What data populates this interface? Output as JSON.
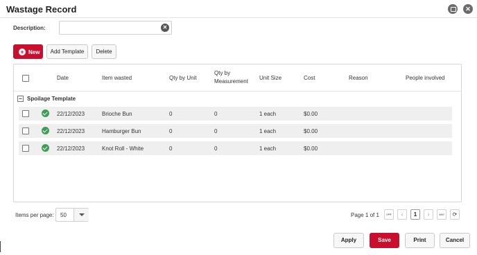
{
  "window": {
    "title": "Wastage Record",
    "minimize_icon": "window-restore-icon",
    "close_icon": "close-icon",
    "close_glyph": "✕"
  },
  "description": {
    "label": "Description:",
    "value": "",
    "placeholder": "",
    "clear_icon": "clear-icon",
    "clear_glyph": "✕"
  },
  "toolbar": {
    "new_label": "New",
    "new_icon": "plus-circle-icon",
    "new_glyph": "+",
    "add_template_label": "Add Template",
    "delete_label": "Delete"
  },
  "accent_color": "#c8102e",
  "status_color": "#3f9d58",
  "table": {
    "headers": {
      "date": "Date",
      "item_wasted": "Item wasted",
      "qty_by_unit": "Qty by Unit",
      "qty_by_measurement_1": "Qty by",
      "qty_by_measurement_2": "Measurement",
      "unit_size": "Unit Size",
      "cost": "Cost",
      "reason": "Reason",
      "people_involved": "People involved"
    },
    "group": {
      "toggle": "−",
      "label": "Spoilage Template"
    },
    "rows": [
      {
        "date": "22/12/2023",
        "item": "Brioche Bun",
        "qty_unit": "0",
        "qty_measure": "0",
        "unit_size": "1 each",
        "cost": "$0.00",
        "reason": "",
        "people": "",
        "status_icon": "check-circle-icon"
      },
      {
        "date": "22/12/2023",
        "item": "Hamburger Bun",
        "qty_unit": "0",
        "qty_measure": "0",
        "unit_size": "1 each",
        "cost": "$0.00",
        "reason": "",
        "people": "",
        "status_icon": "check-circle-icon"
      },
      {
        "date": "22/12/2023",
        "item": "Knot Roll - White",
        "qty_unit": "0",
        "qty_measure": "0",
        "unit_size": "1 each",
        "cost": "$0.00",
        "reason": "",
        "people": "",
        "status_icon": "check-circle-icon"
      }
    ]
  },
  "pagination": {
    "items_per_page_label": "Items per page:",
    "items_per_page_value": "50",
    "page_info": "Page 1 of 1",
    "first": "⏮",
    "prev": "‹",
    "current": "1",
    "next": "›",
    "last": "⏭",
    "refresh": "⟳"
  },
  "footer": {
    "apply_label": "Apply",
    "save_label": "Save",
    "print_label": "Print",
    "cancel_label": "Cancel"
  }
}
